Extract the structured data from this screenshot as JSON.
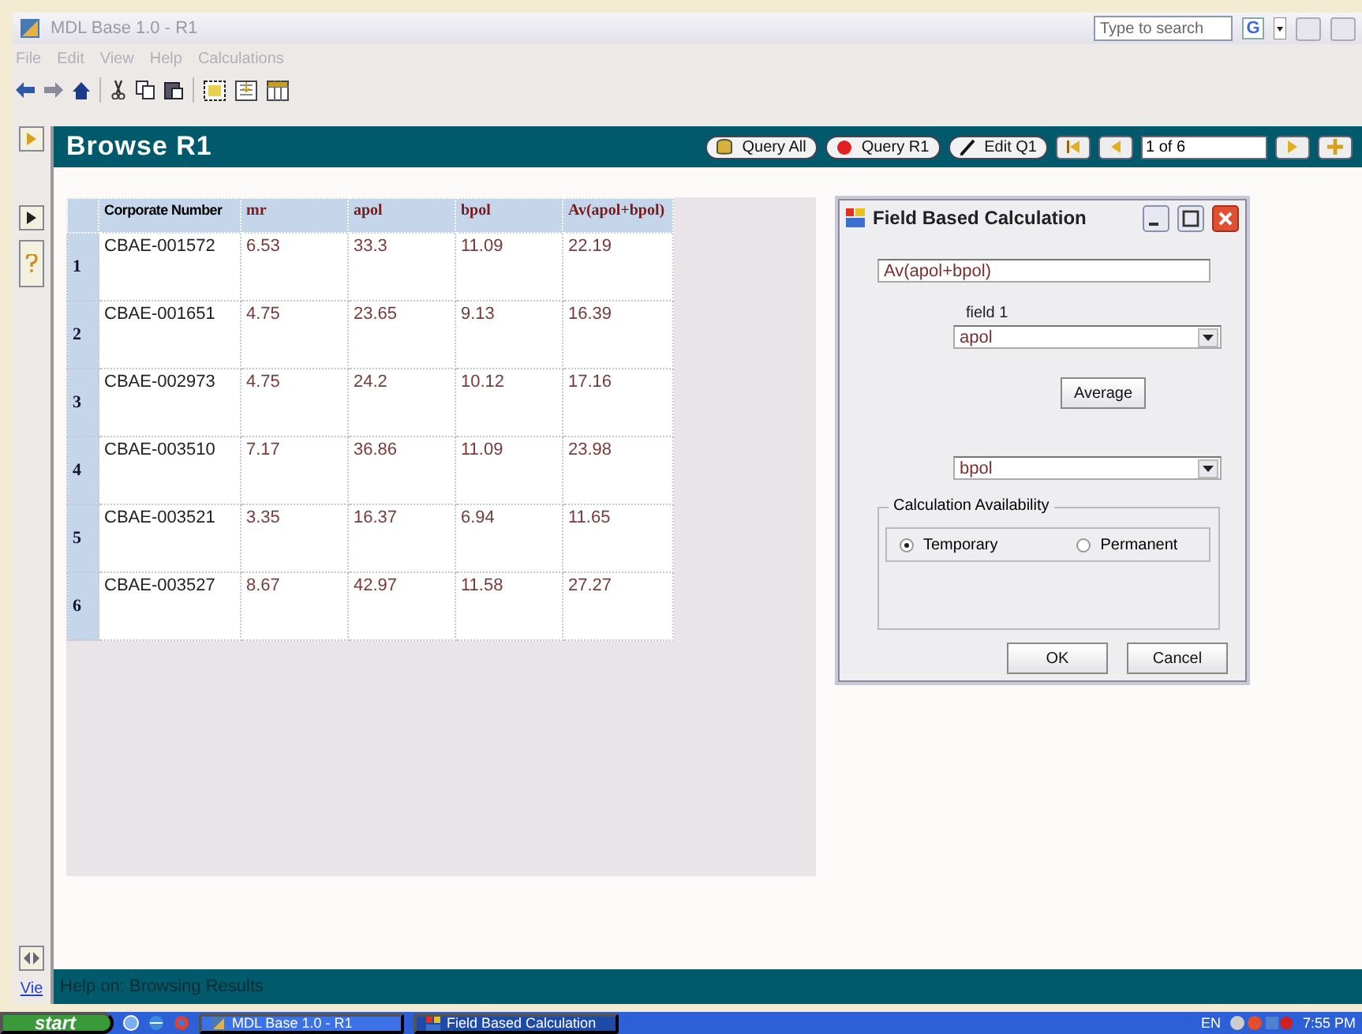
{
  "window": {
    "title": "MDL Base 1.0 - R1",
    "search": {
      "placeholder": "Type to search",
      "engine": "G"
    }
  },
  "menu": [
    "File",
    "Edit",
    "View",
    "Help",
    "Calculations"
  ],
  "header": {
    "title": "Browse R1",
    "buttons": [
      {
        "label": "Query All",
        "kind": "db"
      },
      {
        "label": "Query R1",
        "kind": "dot"
      },
      {
        "label": "Edit Q1",
        "kind": "pen"
      }
    ],
    "record": "1 of 6"
  },
  "side_link": "Vie",
  "table": {
    "columns": [
      "Corporate Number",
      "mr",
      "apol",
      "bpol",
      "Av(apol+bpol)"
    ],
    "rows": [
      {
        "index": "1",
        "cells": [
          "CBAE-001572",
          "6.53",
          "33.3",
          "11.09",
          "22.19"
        ]
      },
      {
        "index": "2",
        "cells": [
          "CBAE-001651",
          "4.75",
          "23.65",
          "9.13",
          "16.39"
        ]
      },
      {
        "index": "3",
        "cells": [
          "CBAE-002973",
          "4.75",
          "24.2",
          "10.12",
          "17.16"
        ]
      },
      {
        "index": "4",
        "cells": [
          "CBAE-003510",
          "7.17",
          "36.86",
          "11.09",
          "23.98"
        ]
      },
      {
        "index": "5",
        "cells": [
          "CBAE-003521",
          "3.35",
          "16.37",
          "6.94",
          "11.65"
        ]
      },
      {
        "index": "6",
        "cells": [
          "CBAE-003527",
          "8.67",
          "42.97",
          "11.58",
          "27.27"
        ]
      }
    ]
  },
  "dialog": {
    "title": "Field Based Calculation",
    "formula": "Av(apol+bpol)",
    "field1_label": "field 1",
    "field1": "apol",
    "operation": "Average",
    "field2": "bpol",
    "group_label": "Calculation Availability",
    "options": [
      {
        "label": "Temporary",
        "selected": true
      },
      {
        "label": "Permanent",
        "selected": false
      }
    ],
    "buttons": [
      "OK",
      "Cancel"
    ]
  },
  "status_bar": "Help on: Browsing Results",
  "taskbar": {
    "start": "start",
    "tasks": [
      {
        "label": "MDL Base 1.0 - R1",
        "selected": false
      },
      {
        "label": "Field Based Calculation",
        "selected": true
      }
    ],
    "language": "EN",
    "clock": "7:55 PM"
  }
}
